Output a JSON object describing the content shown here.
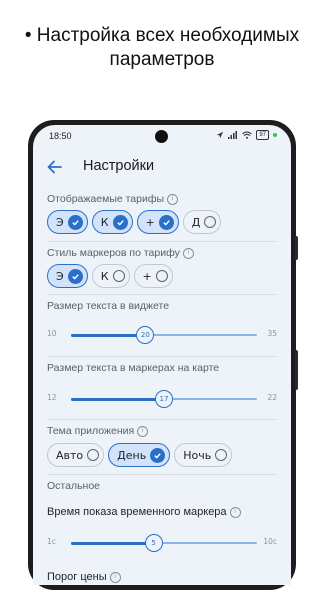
{
  "headline": {
    "line1": "• Настройка всех необходимых",
    "line2": "параметров"
  },
  "status_bar": {
    "time": "18:50",
    "battery": "97"
  },
  "app_bar": {
    "title": "Настройки",
    "back_icon": "arrow-left-icon"
  },
  "tariffs": {
    "label": "Отображаемые тарифы",
    "chips": [
      {
        "label": "Э",
        "checked": true
      },
      {
        "label": "К",
        "checked": true
      },
      {
        "label": "+",
        "checked": true
      },
      {
        "label": "Д",
        "checked": false
      }
    ]
  },
  "marker_style": {
    "label": "Стиль маркеров по тарифу",
    "chips": [
      {
        "label": "Э",
        "checked": true
      },
      {
        "label": "К",
        "checked": false
      },
      {
        "label": "+",
        "checked": false
      }
    ]
  },
  "widget_text": {
    "label": "Размер текста в виджете",
    "min": "10",
    "max": "35",
    "value": "20",
    "fraction": 0.4
  },
  "marker_text": {
    "label": "Размер текста в маркерах на карте",
    "min": "12",
    "max": "22",
    "value": "17",
    "fraction": 0.5
  },
  "theme": {
    "label": "Тема приложения",
    "options": [
      {
        "label": "Авто",
        "checked": false
      },
      {
        "label": "День",
        "checked": true
      },
      {
        "label": "Ночь",
        "checked": false
      }
    ]
  },
  "other": {
    "section": "Остальное",
    "timer_label": "Время показа временного маркера",
    "min": "1с",
    "max": "10с",
    "value": "5",
    "fraction": 0.444,
    "next_label": "Порог цены"
  },
  "colors": {
    "accent": "#2a70c8",
    "chip_selected": "#d3e3fb",
    "screen_bg": "#eef3fa"
  }
}
